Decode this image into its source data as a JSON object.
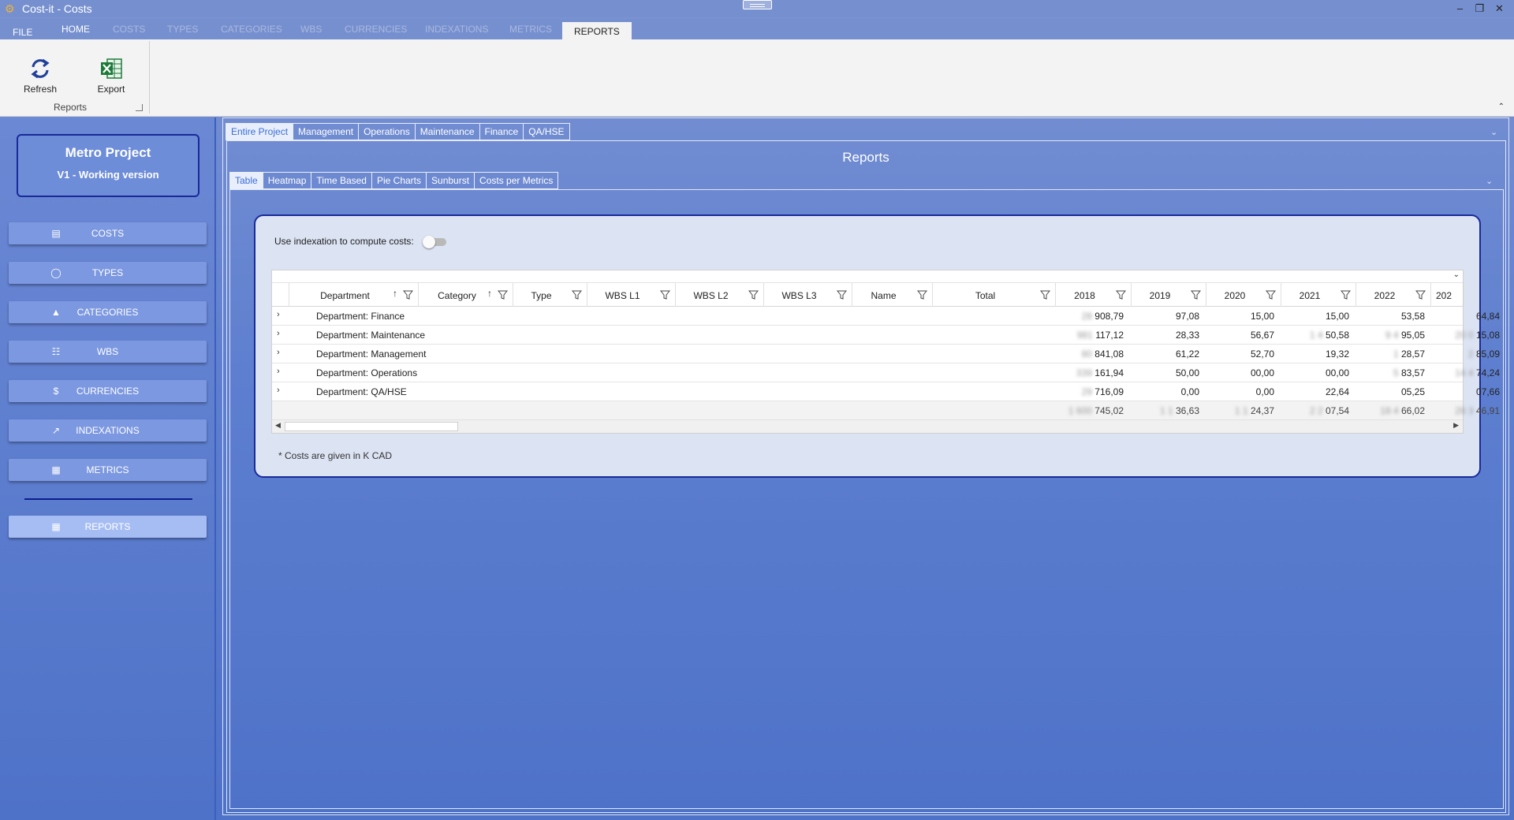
{
  "window": {
    "title": "Cost-it - Costs"
  },
  "ribbon_tabs": [
    {
      "label": "FILE"
    },
    {
      "label": "HOME"
    },
    {
      "label": "COSTS"
    },
    {
      "label": "TYPES"
    },
    {
      "label": "CATEGORIES"
    },
    {
      "label": "WBS"
    },
    {
      "label": "CURRENCIES"
    },
    {
      "label": "INDEXATIONS"
    },
    {
      "label": "METRICS"
    },
    {
      "label": "REPORTS"
    }
  ],
  "ribbon": {
    "refresh_label": "Refresh",
    "export_label": "Export",
    "group_label": "Reports"
  },
  "project": {
    "name": "Metro Project",
    "version": "V1 - Working version"
  },
  "nav": [
    {
      "label": "COSTS",
      "icon": "cash-icon"
    },
    {
      "label": "TYPES",
      "icon": "circle-icon"
    },
    {
      "label": "CATEGORIES",
      "icon": "shapes-icon"
    },
    {
      "label": "WBS",
      "icon": "hierarchy-icon"
    },
    {
      "label": "CURRENCIES",
      "icon": "dollar-icon"
    },
    {
      "label": "INDEXATIONS",
      "icon": "line-chart-icon"
    },
    {
      "label": "METRICS",
      "icon": "calculator-icon"
    },
    {
      "label": "REPORTS",
      "icon": "dashboard-icon",
      "active": true
    }
  ],
  "scope_tabs": [
    {
      "label": "Entire Project",
      "active": true
    },
    {
      "label": "Management"
    },
    {
      "label": "Operations"
    },
    {
      "label": "Maintenance"
    },
    {
      "label": "Finance"
    },
    {
      "label": "QA/HSE"
    }
  ],
  "reports_title": "Reports",
  "view_tabs": [
    {
      "label": "Table",
      "active": true
    },
    {
      "label": "Heatmap"
    },
    {
      "label": "Time Based"
    },
    {
      "label": "Pie Charts"
    },
    {
      "label": "Sunburst"
    },
    {
      "label": "Costs per Metrics"
    }
  ],
  "indexation_label": "Use indexation to compute costs:",
  "indexation_on": false,
  "grid": {
    "columns": [
      "Department",
      "Category",
      "Type",
      "WBS L1",
      "WBS L2",
      "WBS L3",
      "Name",
      "Total",
      "2018",
      "2019",
      "2020",
      "2021",
      "2022",
      "202"
    ],
    "rows": [
      {
        "label": "Department: Finance",
        "hidden": [
          "28",
          "",
          "",
          "",
          "",
          ""
        ],
        "values": [
          "908,79",
          "97,08",
          "15,00",
          "15,00",
          "53,58",
          "64,84"
        ]
      },
      {
        "label": "Department: Maintenance",
        "hidden": [
          "981",
          "",
          "",
          "1 4",
          "9 4",
          "20 0"
        ],
        "values": [
          "117,12",
          "28,33",
          "56,67",
          "50,58",
          "95,05",
          "15,08"
        ]
      },
      {
        "label": "Department: Management",
        "hidden": [
          "80",
          "",
          "",
          "",
          "1",
          "2"
        ],
        "values": [
          "841,08",
          "61,22",
          "52,70",
          "19,32",
          "28,57",
          "85,09"
        ]
      },
      {
        "label": "Department: Operations",
        "hidden": [
          "339",
          "",
          "",
          "",
          "5",
          "14 4"
        ],
        "values": [
          "161,94",
          "50,00",
          "00,00",
          "00,00",
          "83,57",
          "74,24"
        ]
      },
      {
        "label": "Department: QA/HSE",
        "hidden": [
          "29",
          "",
          "",
          "",
          "",
          ""
        ],
        "values": [
          "716,09",
          "0,00",
          "0,00",
          "22,64",
          "05,25",
          "07,66"
        ]
      }
    ],
    "totals": {
      "hidden": [
        "1 600",
        "1 1",
        "1 1",
        "2 2",
        "18 4",
        "28 3"
      ],
      "values": [
        "745,02",
        "36,63",
        "24,37",
        "07,54",
        "66,02",
        "46,91"
      ]
    }
  },
  "footnote": "* Costs are given in K CAD"
}
